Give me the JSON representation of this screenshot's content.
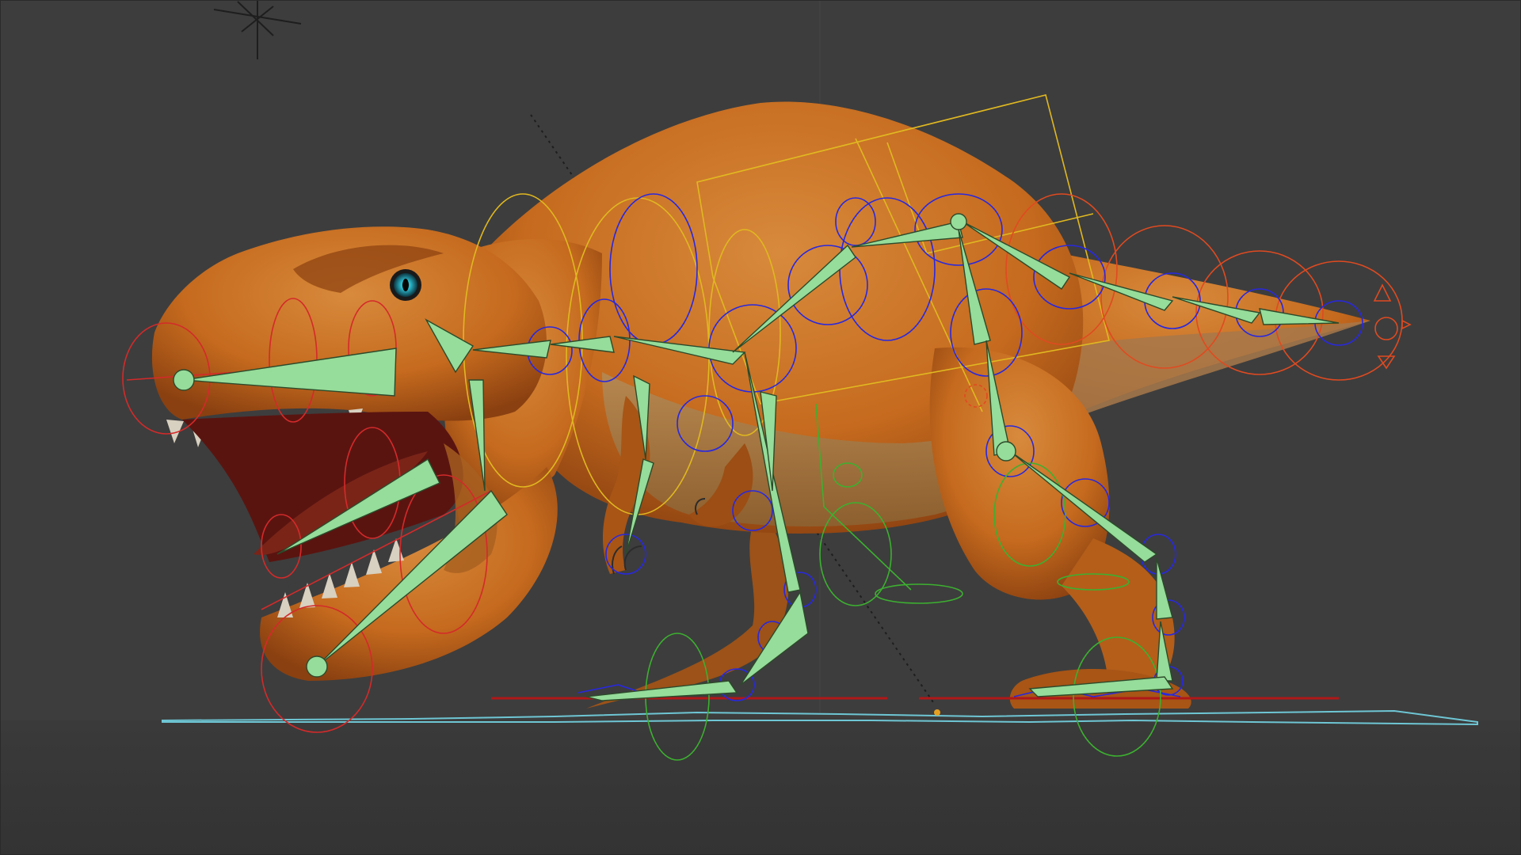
{
  "app": {
    "name": "3D viewport"
  },
  "viewport": {
    "background": "#3d3d3d",
    "grid_color": "#353535",
    "floor_color": "#383838",
    "x_axis_color": "#b01818",
    "floor_outline_color": "#6ec6d4",
    "origin_marker_color": "#e6a020"
  },
  "model": {
    "subject": "tyrannosaurus",
    "skin_color": "#c56a1e",
    "skin_dark": "#8a4010",
    "skin_light": "#d8934a",
    "belly_color": "#b48a55",
    "eye_color": "#2ec4d8",
    "teeth_color": "#d8d0c0",
    "mouth_color": "#5a1410"
  },
  "rig": {
    "bone_fill": "#96dc9a",
    "bone_stroke": "#2c4a2a",
    "control_colors": {
      "head": "#d42a2a",
      "spine": "#e0b820",
      "fk": "#2828e0",
      "ik": "#3cb030",
      "tail": "#e04a20"
    }
  },
  "icons": {
    "light": "light-icon",
    "camera_line": "camera-line-icon"
  }
}
